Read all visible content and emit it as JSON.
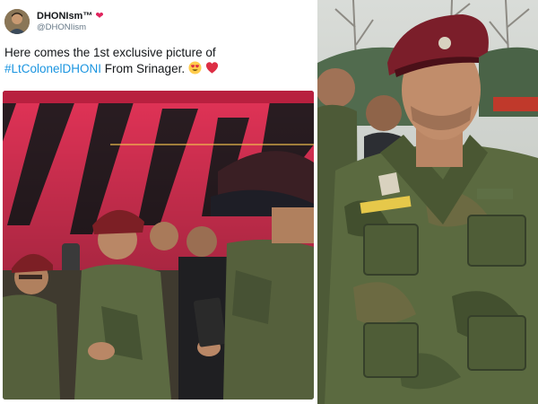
{
  "tweet": {
    "display_name": "DHONIsm™",
    "handle": "@DHONIism",
    "text_line1": "Here comes the 1st exclusive picture of",
    "hashtag": "#LtColonelDHONI",
    "text_line2_rest": " From Srinager.",
    "emojis": [
      "heart-eyes-emoji",
      "red-heart-emoji"
    ]
  },
  "colors": {
    "hashtag": "#1b95e0",
    "text": "#14171a",
    "handle": "#657786",
    "heart": "#e0245e"
  }
}
